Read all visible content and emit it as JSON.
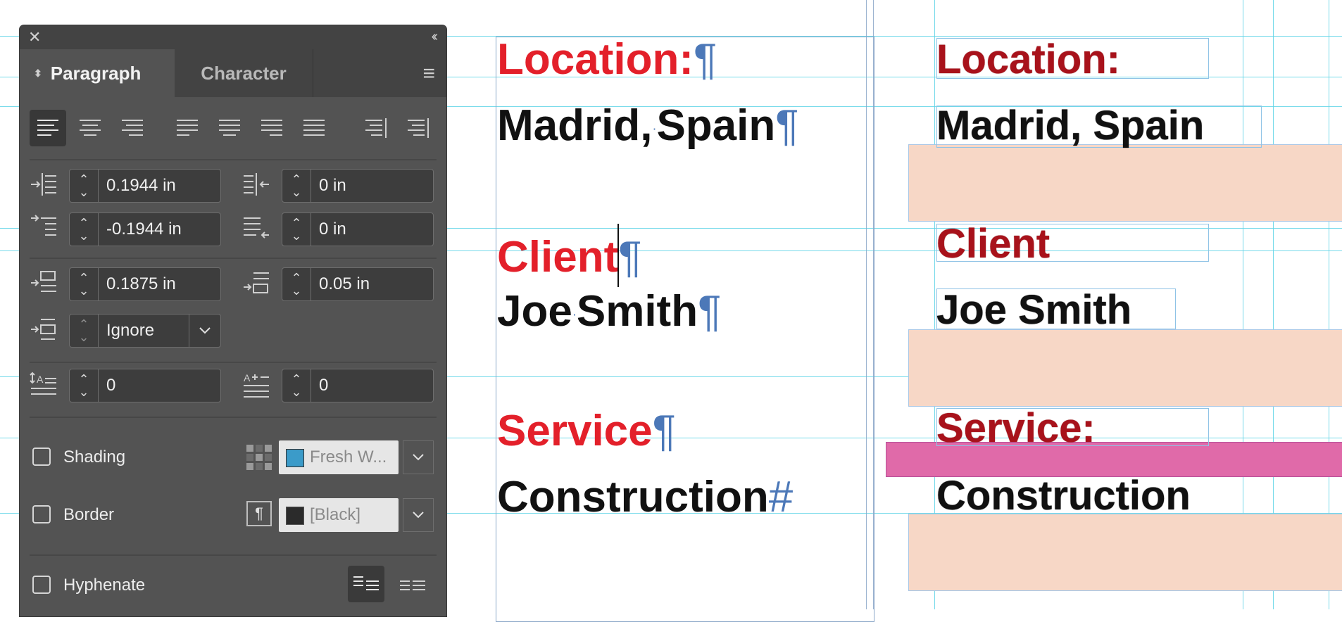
{
  "panel": {
    "close_glyph": "✕",
    "collapse_glyph": "‹‹",
    "tab_paragraph": "Paragraph",
    "tab_character": "Character",
    "menu_glyph": "≡",
    "left_indent": "0.1944 in",
    "right_indent": "0 in",
    "first_line_indent": "-0.1944 in",
    "last_line_right_indent": "0 in",
    "space_before": "0.1875 in",
    "space_after": "0.05 in",
    "align_to_grid": "Ignore",
    "drop_cap_lines": "0",
    "drop_cap_chars": "0",
    "shading_label": "Shading",
    "shading_swatch": "Fresh W...",
    "shading_color": "#3b9bc9",
    "border_label": "Border",
    "border_swatch": "[Black]",
    "border_color": "#2b2b2b",
    "hyphenate_label": "Hyphenate"
  },
  "document": {
    "heading1": "Location:",
    "body1a": "Madrid,",
    "body1b": "Spain",
    "heading2a": "Client",
    "heading2b": "",
    "body2a": "Joe",
    "body2b": "Smith",
    "heading3": "Service",
    "body3": "Construction",
    "pilcrow": "¶",
    "end_mark": "#"
  },
  "preview": {
    "heading1": "Location:",
    "body1": "Madrid, Spain",
    "heading2": "Client",
    "body2": "Joe Smith",
    "heading3": "Service:",
    "body3": "Construction"
  }
}
